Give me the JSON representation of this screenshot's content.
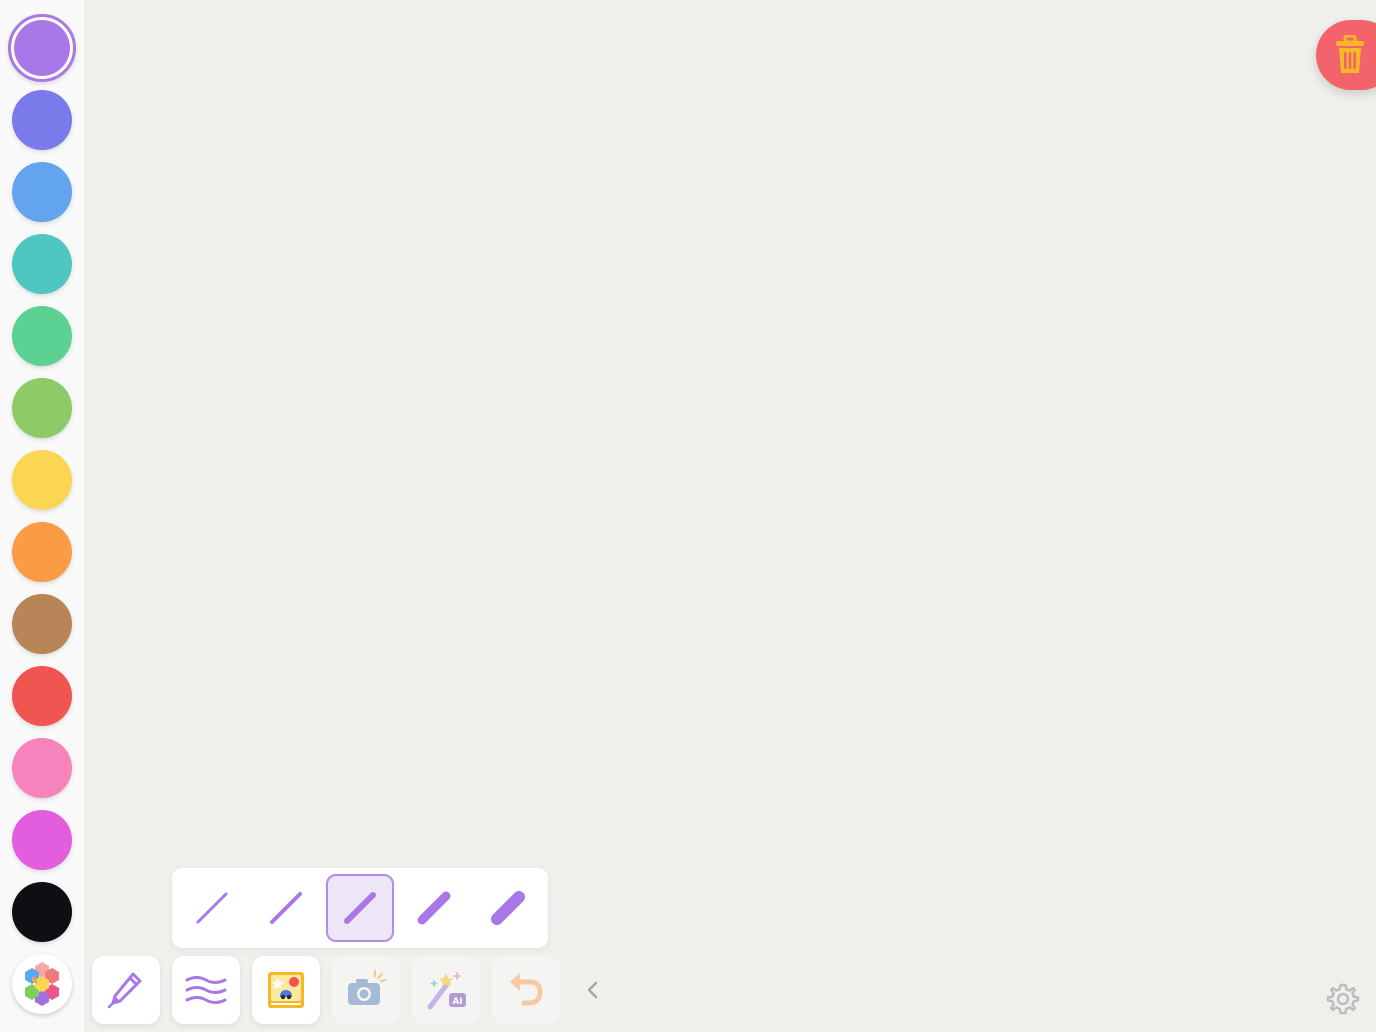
{
  "palette": {
    "selected_color": "#a977e8",
    "colors": [
      {
        "name": "purple",
        "hex": "#a977e8"
      },
      {
        "name": "indigo",
        "hex": "#7b7aeb"
      },
      {
        "name": "blue",
        "hex": "#62a4ee"
      },
      {
        "name": "teal",
        "hex": "#4fc7c1"
      },
      {
        "name": "green",
        "hex": "#5bd293"
      },
      {
        "name": "lime",
        "hex": "#8ecb66"
      },
      {
        "name": "yellow",
        "hex": "#fbd653"
      },
      {
        "name": "orange",
        "hex": "#fc9b46"
      },
      {
        "name": "brown",
        "hex": "#b88559"
      },
      {
        "name": "red",
        "hex": "#f05552"
      },
      {
        "name": "pink",
        "hex": "#f683bb"
      },
      {
        "name": "magenta",
        "hex": "#e35ede"
      },
      {
        "name": "black",
        "hex": "#0d0f12"
      }
    ],
    "custom_color_icon": "hexagon-color-wheel-icon"
  },
  "brush_sizes": {
    "selected_index": 2,
    "options": [
      1,
      2,
      3,
      4,
      5
    ]
  },
  "toolbar": {
    "tools": [
      {
        "id": "pen",
        "icon": "pen-icon",
        "enabled": true
      },
      {
        "id": "stroke-style",
        "icon": "wave-lines-icon",
        "enabled": true
      },
      {
        "id": "stickers",
        "icon": "sticker-book-icon",
        "enabled": true
      },
      {
        "id": "camera",
        "icon": "camera-icon",
        "enabled": false
      },
      {
        "id": "ai-magic",
        "icon": "ai-magic-wand-icon",
        "enabled": false,
        "badge": "AI"
      },
      {
        "id": "undo",
        "icon": "undo-icon",
        "enabled": false
      }
    ],
    "collapse_icon": "chevron-left-icon"
  },
  "actions": {
    "clear_icon": "trash-icon",
    "settings_icon": "gear-icon"
  },
  "colors": {
    "accent": "#a977e8",
    "trash_bg": "#f2636b",
    "trash_icon": "#f7b825",
    "canvas_bg": "#efefec"
  }
}
